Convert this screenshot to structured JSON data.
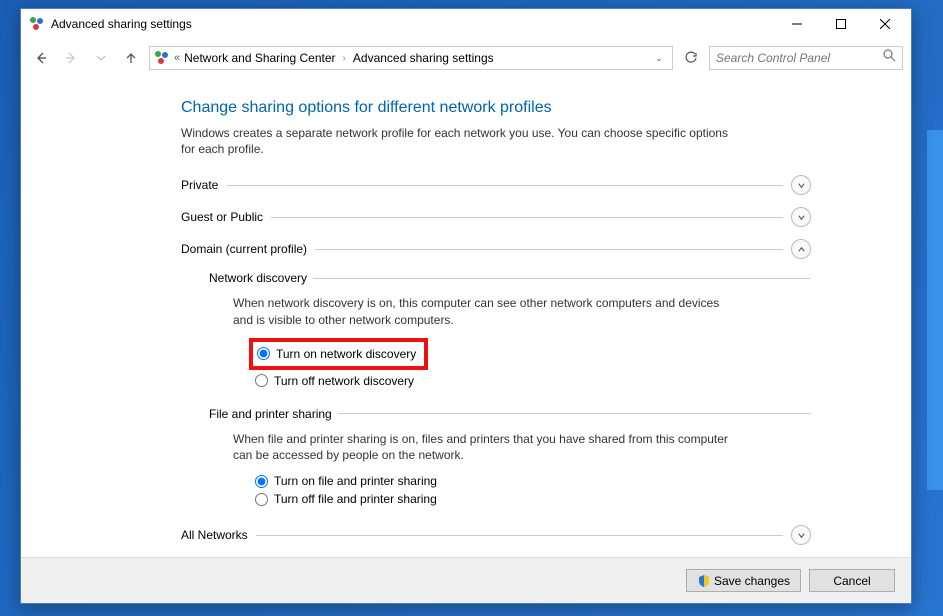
{
  "window": {
    "title": "Advanced sharing settings"
  },
  "breadcrumb": {
    "parent": "Network and Sharing Center",
    "current": "Advanced sharing settings"
  },
  "search": {
    "placeholder": "Search Control Panel"
  },
  "page": {
    "title": "Change sharing options for different network profiles",
    "description": "Windows creates a separate network profile for each network you use. You can choose specific options for each profile."
  },
  "sections": {
    "private": {
      "label": "Private"
    },
    "guest": {
      "label": "Guest or Public"
    },
    "domain": {
      "label": "Domain (current profile)"
    },
    "all": {
      "label": "All Networks"
    }
  },
  "domain": {
    "network_discovery": {
      "title": "Network discovery",
      "description": "When network discovery is on, this computer can see other network computers and devices and is visible to other network computers.",
      "on_label": "Turn on network discovery",
      "off_label": "Turn off network discovery"
    },
    "file_printer": {
      "title": "File and printer sharing",
      "description": "When file and printer sharing is on, files and printers that you have shared from this computer can be accessed by people on the network.",
      "on_label": "Turn on file and printer sharing",
      "off_label": "Turn off file and printer sharing"
    }
  },
  "buttons": {
    "save": "Save changes",
    "cancel": "Cancel"
  }
}
